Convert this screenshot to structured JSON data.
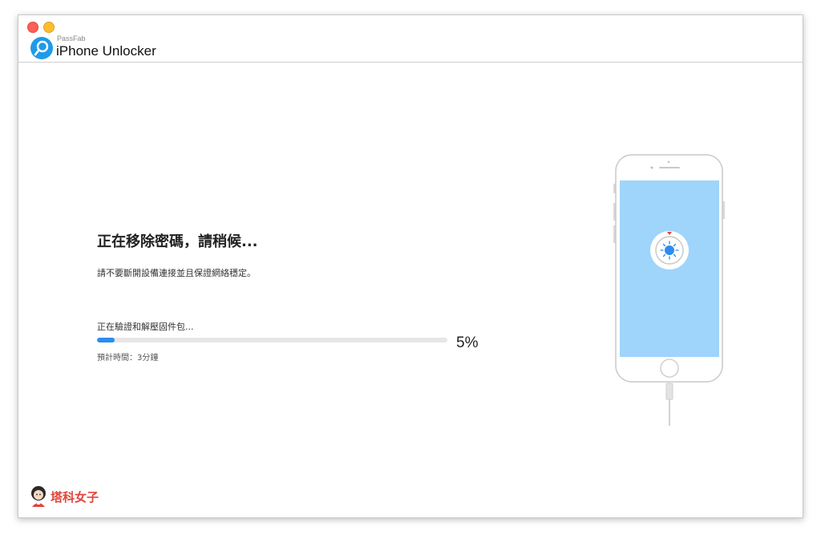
{
  "window": {
    "brand": "PassFab",
    "app_title": "iPhone Unlocker"
  },
  "status": {
    "heading": "正在移除密碼，請稍候...",
    "subtext": "請不要斷開設備連接並且保證網絡穩定。"
  },
  "progress": {
    "label": "正在驗證和解壓固件包...",
    "percent_text": "5%",
    "value": 0.05,
    "eta": "預計時間：3分鐘"
  },
  "watermark": {
    "text": "塔科女子"
  },
  "colors": {
    "accent": "#2d8cf0",
    "screen": "#9fd4fb",
    "logo": "#1e9be8",
    "watermark": "#e0453a"
  },
  "icons": [
    "close-icon",
    "minimize-icon",
    "passfab-logo-icon",
    "iphone-illustration",
    "unlock-dial-icon"
  ]
}
